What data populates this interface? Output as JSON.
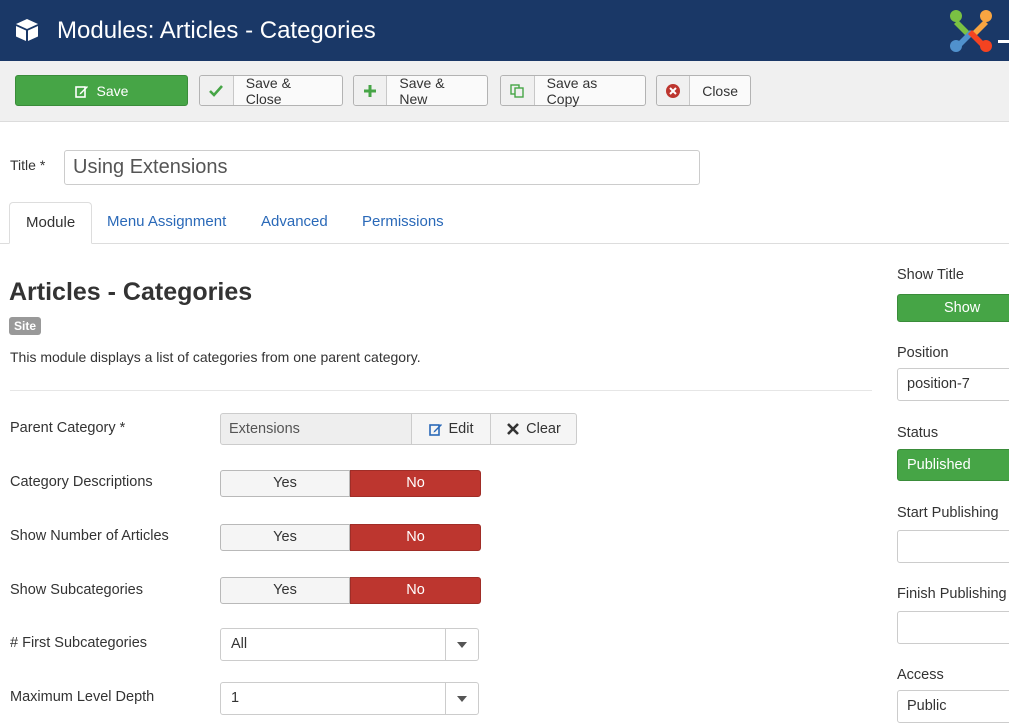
{
  "header": {
    "title": "Modules: Articles - Categories"
  },
  "toolbar": {
    "save": "Save",
    "save_close": "Save & Close",
    "save_new": "Save & New",
    "save_copy": "Save as Copy",
    "close": "Close"
  },
  "title_field": {
    "label": "Title *",
    "value": "Using Extensions"
  },
  "tabs": [
    "Module",
    "Menu Assignment",
    "Advanced",
    "Permissions"
  ],
  "module": {
    "heading": "Articles - Categories",
    "badge": "Site",
    "description": "This module displays a list of categories from one parent category."
  },
  "fields": {
    "parent_category": {
      "label": "Parent Category *",
      "value": "Extensions",
      "edit": "Edit",
      "clear": "Clear"
    },
    "category_descriptions": {
      "label": "Category Descriptions",
      "yes": "Yes",
      "no": "No"
    },
    "show_number_articles": {
      "label": "Show Number of Articles",
      "yes": "Yes",
      "no": "No"
    },
    "show_subcategories": {
      "label": "Show Subcategories",
      "yes": "Yes",
      "no": "No"
    },
    "first_subcategories": {
      "label": "# First Subcategories",
      "value": "All"
    },
    "max_level_depth": {
      "label": "Maximum Level Depth",
      "value": "1"
    }
  },
  "sidebar": {
    "show_title": {
      "label": "Show Title",
      "value": "Show"
    },
    "position": {
      "label": "Position",
      "value": "position-7"
    },
    "status": {
      "label": "Status",
      "value": "Published"
    },
    "start_publishing": {
      "label": "Start Publishing",
      "value": ""
    },
    "finish_publishing": {
      "label": "Finish Publishing",
      "value": ""
    },
    "access": {
      "label": "Access",
      "value": "Public"
    }
  },
  "colors": {
    "header": "#1a3867",
    "success": "#46a546",
    "danger": "#bd362f",
    "link": "#2a69b8"
  }
}
